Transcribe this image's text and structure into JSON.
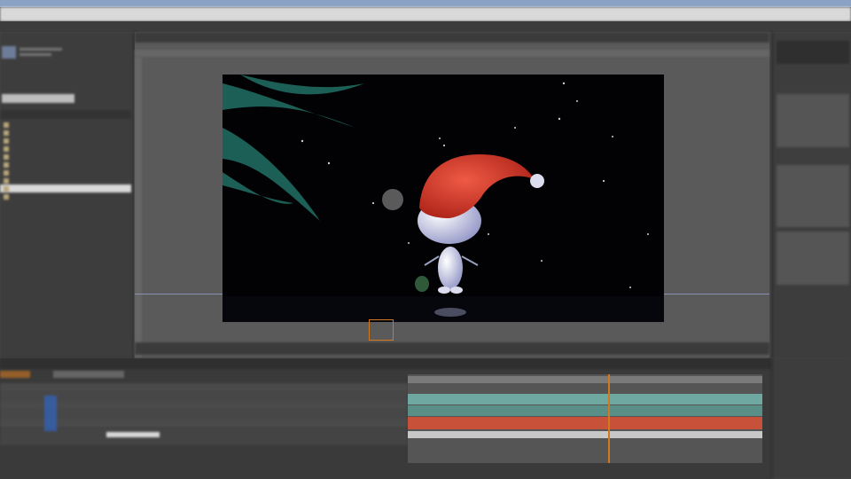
{
  "window": {
    "menu": [
      "",
      "",
      "",
      "",
      "",
      "",
      "",
      "",
      ""
    ]
  },
  "project": {
    "items": [
      {
        "label": "",
        "selected": false
      },
      {
        "label": "",
        "selected": false
      },
      {
        "label": "",
        "selected": false
      },
      {
        "label": "",
        "selected": false
      },
      {
        "label": "",
        "selected": false
      },
      {
        "label": "",
        "selected": false
      },
      {
        "label": "",
        "selected": false
      },
      {
        "label": "",
        "selected": false
      },
      {
        "label": "",
        "selected": true
      },
      {
        "label": "",
        "selected": false
      }
    ]
  },
  "timeline": {
    "tracks": [
      {
        "color": "#6fa8a0"
      },
      {
        "color": "#5a8f88"
      },
      {
        "color": "#c8513a"
      },
      {
        "color": "#c8c8c8"
      }
    ],
    "current_time_indicator_color": "#d2781e"
  },
  "colors": {
    "accent": "#d2781e",
    "hat": "#d63a2a",
    "tree": "#1f6a5f"
  }
}
